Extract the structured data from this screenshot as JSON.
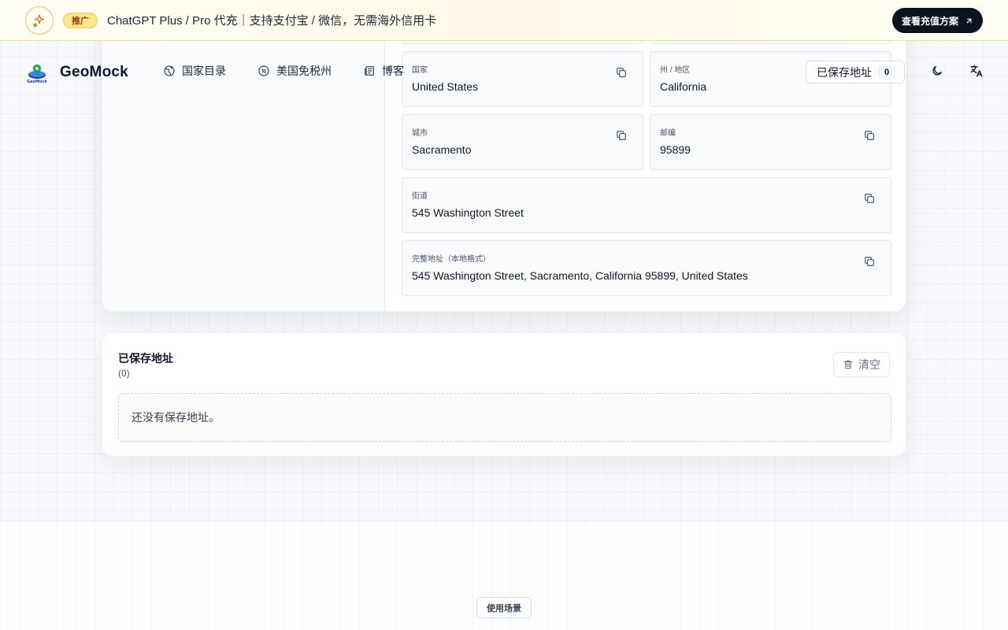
{
  "promo": {
    "badge": "推广",
    "text": "ChatGPT Plus / Pro 代充｜支持支付宝 / 微信，无需海外信用卡",
    "cta": "查看充值方案",
    "accent": "#f4c95a"
  },
  "header": {
    "brand": "GeoMock",
    "nav": [
      {
        "label": "国家目录",
        "icon": "globe-icon"
      },
      {
        "label": "美国免税州",
        "icon": "percent-icon"
      },
      {
        "label": "博客",
        "icon": "newspaper-icon"
      }
    ],
    "saved_button": {
      "label": "已保存地址",
      "count": "0"
    },
    "theme_icon": "moon-icon",
    "language_icon": "translate-icon"
  },
  "address": {
    "fields": {
      "country": {
        "label": "国家",
        "value": "United States"
      },
      "state": {
        "label": "州 / 地区",
        "value": "California"
      },
      "city": {
        "label": "城市",
        "value": "Sacramento"
      },
      "zip": {
        "label": "邮编",
        "value": "95899"
      },
      "street": {
        "label": "街道",
        "value": "545 Washington Street"
      },
      "full": {
        "label": "完整地址（本地格式）",
        "value": "545 Washington Street, Sacramento, California 95899, United States"
      }
    }
  },
  "saved": {
    "title": "已保存地址",
    "count_text": "(0)",
    "clear_label": "清空",
    "empty_text": "还没有保存地址。"
  },
  "footer": {
    "scenario_button": "使用场景"
  }
}
